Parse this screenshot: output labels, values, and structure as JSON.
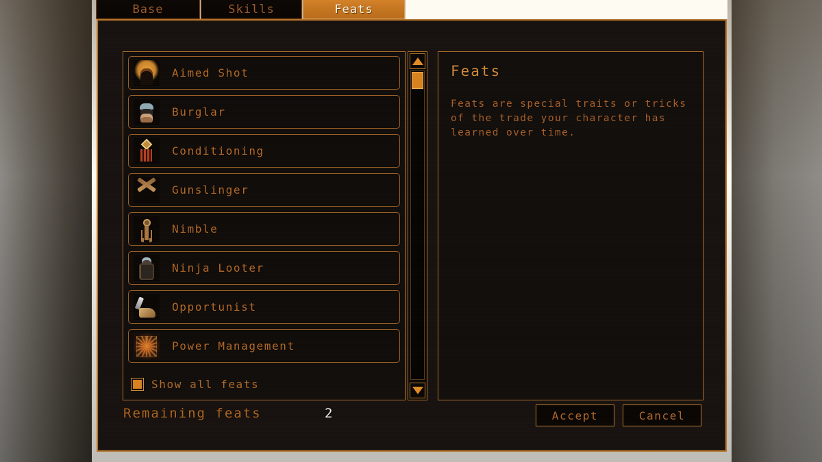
{
  "tabs": [
    {
      "label": "Base",
      "active": false,
      "name": "tab-base"
    },
    {
      "label": "Skills",
      "active": false,
      "name": "tab-skills"
    },
    {
      "label": "Feats",
      "active": true,
      "name": "tab-feats"
    }
  ],
  "feat_list": {
    "items": [
      {
        "label": "Aimed Shot",
        "icon": "aimed-shot-icon"
      },
      {
        "label": "Burglar",
        "icon": "burglar-icon"
      },
      {
        "label": "Conditioning",
        "icon": "conditioning-icon"
      },
      {
        "label": "Gunslinger",
        "icon": "gunslinger-icon"
      },
      {
        "label": "Nimble",
        "icon": "nimble-icon"
      },
      {
        "label": "Ninja Looter",
        "icon": "ninja-looter-icon"
      },
      {
        "label": "Opportunist",
        "icon": "opportunist-icon"
      },
      {
        "label": "Power Management",
        "icon": "power-management-icon"
      }
    ],
    "show_all": {
      "label": "Show all feats",
      "checked": true
    }
  },
  "scrollbar": {
    "up_icon": "triangle-up-icon",
    "down_icon": "triangle-down-icon",
    "thumb_position_percent": 0
  },
  "description": {
    "title": "Feats",
    "body": "Feats are special traits or tricks of the trade your character has learned over time."
  },
  "footer": {
    "remaining_label": "Remaining feats",
    "remaining_value": "2",
    "accept_label": "Accept",
    "cancel_label": "Cancel"
  },
  "colors": {
    "accent_orange": "#d8821f",
    "border_orange": "#b5742c",
    "text_orange": "#b06a2b",
    "panel_bg": "#120e0b",
    "dialog_bg": "#17120f",
    "highlight_text": "#f4f2ec"
  }
}
